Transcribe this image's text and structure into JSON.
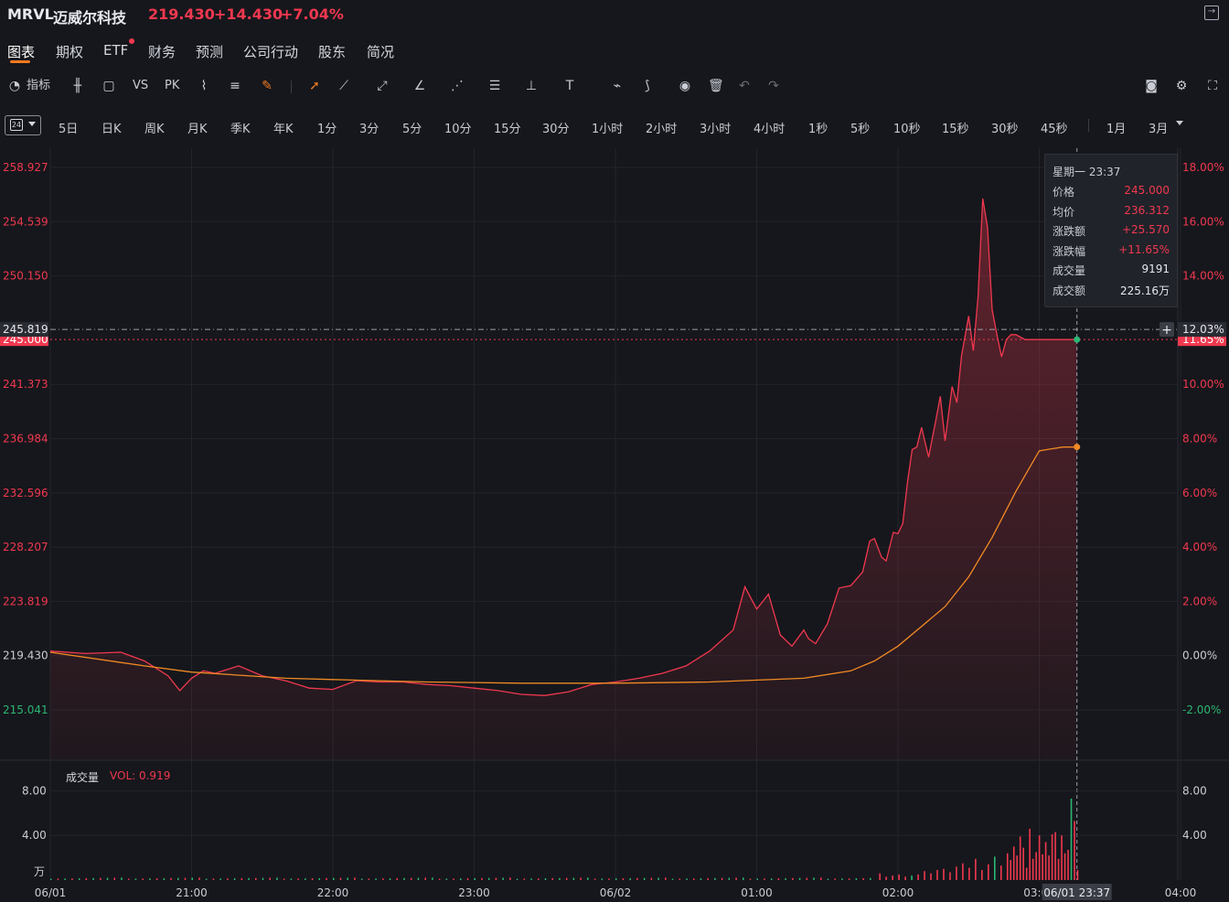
{
  "header": {
    "symbol": "MRVL",
    "name": "迈威尔科技",
    "price": "219.430",
    "change": "+14.430",
    "change_pct": "+7.04%"
  },
  "tabs": [
    {
      "label": "图表",
      "active": true
    },
    {
      "label": "期权"
    },
    {
      "label": "ETF",
      "badge": true
    },
    {
      "label": "财务"
    },
    {
      "label": "预测"
    },
    {
      "label": "公司行动"
    },
    {
      "label": "股东"
    },
    {
      "label": "简况"
    }
  ],
  "toolbar": {
    "indicator_label": "指标",
    "vs_label": "VS",
    "pk_label": "PK"
  },
  "periods": {
    "selected_icon": "24",
    "items": [
      "5日",
      "日K",
      "周K",
      "月K",
      "季K",
      "年K",
      "1分",
      "3分",
      "5分",
      "10分",
      "15分",
      "30分",
      "1小时",
      "2小时",
      "3小时",
      "4小时",
      "1秒",
      "5秒",
      "10秒",
      "15秒",
      "30秒",
      "45秒",
      "1月",
      "3月"
    ]
  },
  "colors": {
    "up": "#f0384f",
    "down": "#2bb673",
    "avg_line": "#f08a24",
    "background": "#16171c"
  },
  "crosshair": {
    "y_price_label": "245.819",
    "y_pct_label": "12.03%",
    "x_label": "06/01 23:37",
    "last_price_label": "245.000",
    "last_pct_label": "11.65%"
  },
  "info_panel": {
    "time": "星期一 23:37",
    "rows": [
      {
        "label": "价格",
        "value": "245.000"
      },
      {
        "label": "均价",
        "value": "236.312"
      },
      {
        "label": "涨跌额",
        "value": "+25.570"
      },
      {
        "label": "涨跌幅",
        "value": "+11.65%"
      },
      {
        "label": "成交量",
        "value": "9191"
      },
      {
        "label": "成交额",
        "value": "225.16万"
      }
    ]
  },
  "volume_panel": {
    "title": "成交量",
    "vol_label": "VOL: 0.919",
    "y_ticks": [
      "8.00",
      "4.00"
    ],
    "unit": "万"
  },
  "chart_data": {
    "type": "line",
    "x_ticks": [
      "06/01",
      "21:00",
      "22:00",
      "23:00",
      "06/02",
      "01:00",
      "02:00",
      "03:00",
      "04:00"
    ],
    "y_left_ticks": [
      "258.927",
      "254.539",
      "250.150",
      "241.373",
      "236.984",
      "232.596",
      "228.207",
      "223.819",
      "219.430",
      "215.041"
    ],
    "y_right_ticks": [
      "18.00%",
      "16.00%",
      "14.00%",
      "10.00%",
      "8.00%",
      "6.00%",
      "4.00%",
      "2.00%",
      "0.00%",
      "-2.00%"
    ],
    "ylim": [
      215.041,
      258.927
    ],
    "prev_close": 219.43,
    "price_series": {
      "minutes": [
        0,
        15,
        30,
        40,
        50,
        55,
        60,
        65,
        70,
        80,
        90,
        100,
        110,
        120,
        130,
        140,
        150,
        160,
        170,
        180,
        190,
        200,
        210,
        220,
        230,
        240,
        250,
        260,
        270,
        280,
        290,
        295,
        300,
        305,
        310,
        315,
        320,
        322,
        325,
        330,
        335,
        340,
        345,
        348,
        350,
        353,
        355,
        358,
        360,
        362,
        364,
        366,
        368,
        370,
        373,
        376,
        378,
        380,
        383,
        385,
        387,
        390,
        392,
        394,
        396,
        398,
        400,
        402,
        404,
        406,
        408,
        410,
        412,
        414,
        416,
        418,
        420,
        422,
        424,
        426,
        428,
        430,
        432,
        434,
        436
      ],
      "values": [
        219.8,
        219.6,
        219.7,
        219.0,
        217.8,
        216.6,
        217.6,
        218.2,
        218.0,
        218.6,
        217.8,
        217.4,
        216.8,
        216.7,
        217.4,
        217.3,
        217.3,
        217.1,
        217.0,
        216.8,
        216.6,
        216.3,
        216.2,
        216.5,
        217.1,
        217.3,
        217.6,
        218.0,
        218.6,
        219.8,
        221.5,
        225.0,
        223.2,
        224.4,
        221.1,
        220.2,
        221.5,
        220.8,
        220.4,
        222.0,
        224.9,
        225.1,
        226.2,
        228.7,
        228.9,
        227.4,
        227.1,
        229.4,
        229.3,
        230.1,
        233.4,
        236.1,
        236.3,
        237.9,
        235.5,
        238.4,
        240.4,
        236.8,
        241.2,
        239.9,
        243.7,
        246.9,
        244.1,
        248.5,
        256.4,
        254.1,
        247.4,
        245.4,
        243.6,
        245.0,
        245.4,
        245.4,
        245.2,
        245.0,
        245.0,
        245.0,
        245.0,
        245.0,
        245.0,
        245.0,
        245.0,
        245.0,
        245.0,
        245.0,
        245.0
      ],
      "end_minute": 436
    },
    "avg_series": {
      "minutes": [
        0,
        40,
        60,
        100,
        120,
        160,
        200,
        240,
        280,
        320,
        340,
        350,
        360,
        370,
        380,
        390,
        400,
        410,
        420,
        430,
        436
      ],
      "values": [
        219.7,
        218.6,
        218.1,
        217.6,
        217.5,
        217.3,
        217.2,
        217.2,
        217.3,
        217.6,
        218.2,
        219.0,
        220.2,
        221.8,
        223.4,
        225.8,
        229.0,
        232.7,
        236.0,
        236.3,
        236.3
      ]
    },
    "volume": {
      "unit": "万",
      "ylim": [
        0,
        10
      ],
      "bars_minutes": [
        352,
        356,
        360,
        364,
        368,
        372,
        376,
        380,
        384,
        388,
        392,
        396,
        400,
        404,
        408,
        412,
        416,
        420,
        424,
        428,
        432,
        434,
        436,
        438,
        440,
        442,
        444,
        446,
        448,
        450,
        452,
        454,
        456,
        458,
        460,
        462,
        464,
        466,
        468,
        470,
        472,
        474,
        476
      ],
      "bars_values": [
        0.6,
        0.3,
        0.4,
        0.5,
        0.3,
        0.4,
        0.5,
        0.8,
        0.6,
        0.9,
        1.0,
        0.7,
        1.2,
        1.5,
        1.1,
        1.9,
        0.9,
        1.4,
        2.1,
        1.3,
        2.4,
        1.8,
        3.0,
        2.2,
        3.9,
        2.9,
        1.1,
        4.6,
        1.9,
        2.5,
        4.0,
        2.3,
        3.4,
        2.2,
        4.1,
        4.3,
        1.9,
        4.0,
        2.4,
        2.7,
        7.3,
        5.3,
        0.9
      ]
    }
  }
}
